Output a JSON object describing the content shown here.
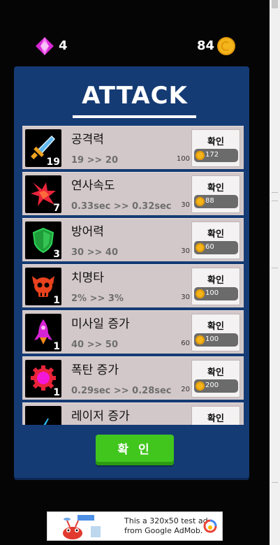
{
  "hud": {
    "gems": "4",
    "coins": "84"
  },
  "title": "ATTACK",
  "upgrades": [
    {
      "name": "공격력",
      "desc": "19 >> 20",
      "level": "19",
      "max": "100",
      "button": "확인",
      "price": "172",
      "icon": "sword-icon"
    },
    {
      "name": "연사속도",
      "desc": "0.33sec >> 0.32sec",
      "level": "7",
      "max": "30",
      "button": "확인",
      "price": "88",
      "icon": "burst-icon"
    },
    {
      "name": "방어력",
      "desc": "30 >> 40",
      "level": "3",
      "max": "30",
      "button": "확인",
      "price": "60",
      "icon": "shield-icon"
    },
    {
      "name": "치명타",
      "desc": "2% >> 3%",
      "level": "1",
      "max": "30",
      "button": "확인",
      "price": "100",
      "icon": "skull-icon"
    },
    {
      "name": "미사일 증가",
      "desc": "40 >> 50",
      "level": "1",
      "max": "60",
      "button": "확인",
      "price": "100",
      "icon": "missile-icon"
    },
    {
      "name": "폭탄 증가",
      "desc": "0.29sec >> 0.28sec",
      "level": "1",
      "max": "20",
      "button": "확인",
      "price": "200",
      "icon": "bomb-icon"
    },
    {
      "name": "레이저 증가",
      "desc": "",
      "level": "",
      "max": "",
      "button": "확인",
      "price": "",
      "icon": "laser-icon"
    }
  ],
  "confirm_label": "확 인",
  "ad": {
    "line1": "This a 320x50 test ad",
    "line2": "from Google AdMob."
  },
  "colors": {
    "panel": "#153b74",
    "row": "#d3c8c9",
    "confirm": "#41c61e",
    "coin": "#f4b51c",
    "gem": "#d829d6"
  }
}
